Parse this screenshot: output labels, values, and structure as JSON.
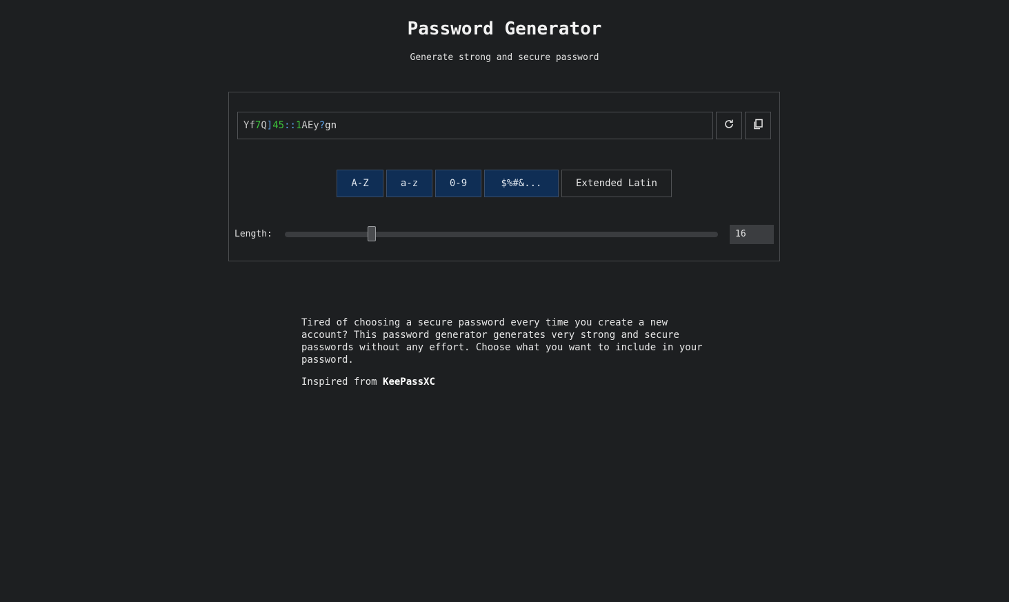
{
  "header": {
    "title": "Password Generator",
    "subtitle": "Generate strong and secure password"
  },
  "password": {
    "value": "Yf7Q]45::1AEy?gn",
    "chars": [
      {
        "c": "Y",
        "color": "#c8c8c8"
      },
      {
        "c": "f",
        "color": "#c8c8c8"
      },
      {
        "c": "7",
        "color": "#3cc43c"
      },
      {
        "c": "Q",
        "color": "#c8c8c8"
      },
      {
        "c": "]",
        "color": "#5aa0e6"
      },
      {
        "c": "4",
        "color": "#3cc43c"
      },
      {
        "c": "5",
        "color": "#3cc43c"
      },
      {
        "c": ":",
        "color": "#5aa0e6"
      },
      {
        "c": ":",
        "color": "#5aa0e6"
      },
      {
        "c": "1",
        "color": "#3cc43c"
      },
      {
        "c": "A",
        "color": "#c8c8c8"
      },
      {
        "c": "E",
        "color": "#c8c8c8"
      },
      {
        "c": "y",
        "color": "#c8c8c8"
      },
      {
        "c": "?",
        "color": "#5aa0e6"
      },
      {
        "c": "g",
        "color": "#e6e6e6"
      },
      {
        "c": "n",
        "color": "#e6e6e6"
      }
    ],
    "regenerate_icon": "refresh-icon",
    "copy_icon": "copy-icon"
  },
  "charsets": [
    {
      "label": "A-Z",
      "active": true
    },
    {
      "label": "a-z",
      "active": true
    },
    {
      "label": "0-9",
      "active": true
    },
    {
      "label": "$%#&...",
      "active": true
    },
    {
      "label": "Extended Latin",
      "active": false
    }
  ],
  "length": {
    "label": "Length:",
    "value": "16",
    "slider_fraction": 0.2
  },
  "description": {
    "text": "Tired of choosing a secure password every time you create a new account? This password generator generates very strong and secure passwords without any effort. Choose what you want to include in your password.",
    "credit_prefix": "Inspired from ",
    "credit_name": "KeePassXC"
  },
  "colors": {
    "background": "#1d1f21",
    "active_button": "#0f2e55",
    "digit": "#3cc43c",
    "symbol": "#5aa0e6"
  }
}
